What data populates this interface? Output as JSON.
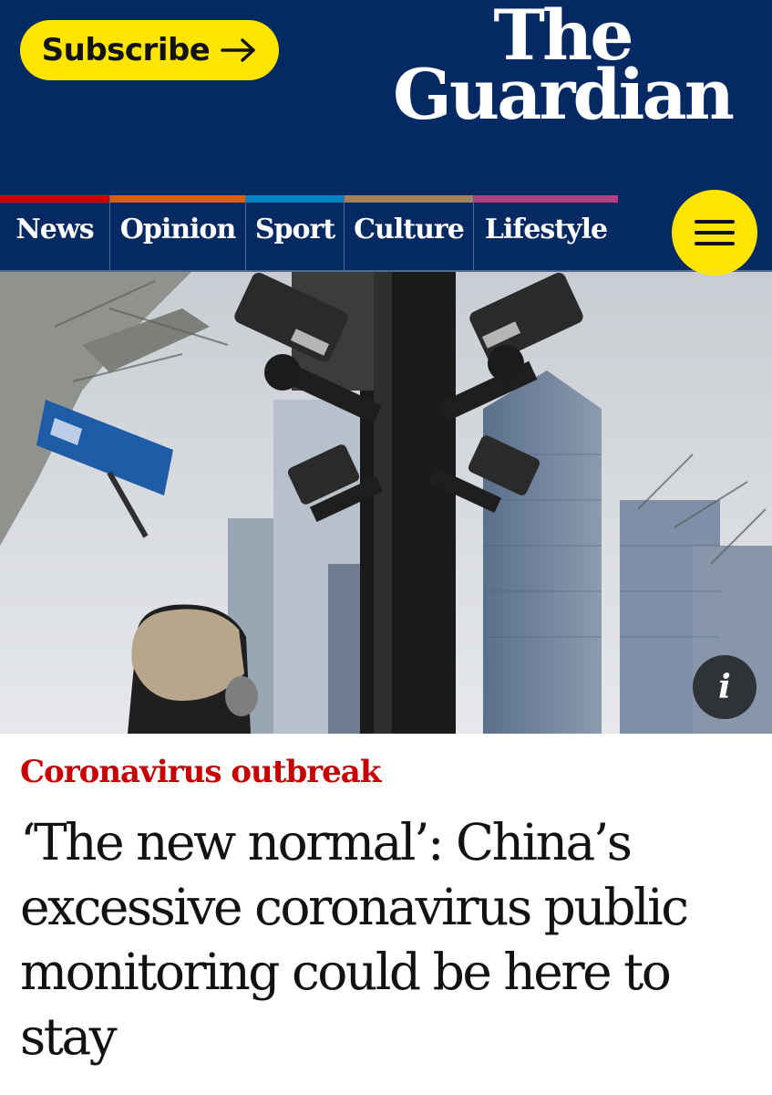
{
  "header": {
    "subscribe_label": "Subscribe",
    "logo_line1": "The",
    "logo_line2": "Guardian",
    "colors": {
      "brand_blue": "#052962",
      "accent_yellow": "#ffe500"
    }
  },
  "nav": {
    "items": [
      {
        "label": "News",
        "color": "#c70000"
      },
      {
        "label": "Opinion",
        "color": "#e05e00"
      },
      {
        "label": "Sport",
        "color": "#0084c6"
      },
      {
        "label": "Culture",
        "color": "#a1845c"
      },
      {
        "label": "Lifestyle",
        "color": "#bb3b80"
      }
    ],
    "menu_icon": "hamburger-icon"
  },
  "hero": {
    "info_icon": "i",
    "description_icon": "info-icon"
  },
  "article": {
    "kicker": "Coronavirus outbreak",
    "kicker_color": "#c70000",
    "headline": "‘The new normal’: China’s excessive coronavirus public monitoring could be here to stay"
  }
}
